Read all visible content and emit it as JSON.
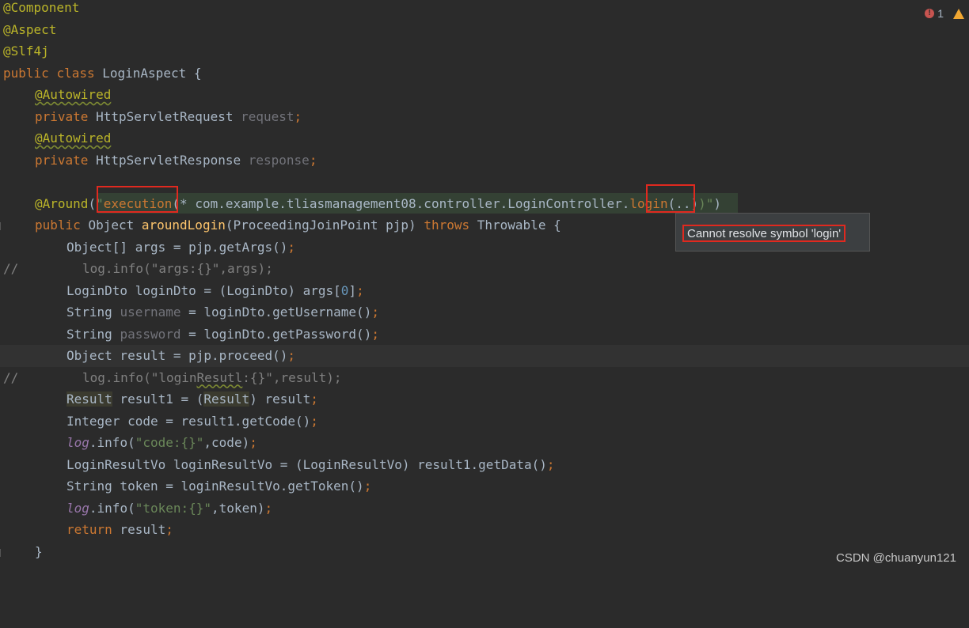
{
  "editor": {
    "l1": {
      "ann": "@Component"
    },
    "l2": {
      "ann": "@Aspect"
    },
    "l3": {
      "ann": "@Slf4j"
    },
    "l4": {
      "k1": "public",
      "k2": "class",
      "name": "LoginAspect",
      "brace": "{"
    },
    "l5": {
      "ann": "@Autowired"
    },
    "l6": {
      "k": "private",
      "type": "HttpServletRequest",
      "field": "request",
      "semi": ";"
    },
    "l7": {
      "ann": "@Autowired"
    },
    "l8": {
      "k": "private",
      "type": "HttpServletResponse",
      "field": "response",
      "semi": ";"
    },
    "l9": {
      "ann": "@Around",
      "p1": "(",
      "q1": "\"",
      "exec": "execution",
      "mid": "(* com.example.tliasmanagement08.controller.LoginController",
      "dot": ".",
      "login": "login",
      "args": "(..)",
      "q2": ")\"",
      "p2": ")"
    },
    "l10": {
      "k": "public",
      "type": "Object",
      "method": "aroundLogin",
      "params": "(ProceedingJoinPoint pjp)",
      "throws": "throws",
      "ex": "Throwable {"
    },
    "l11": {
      "a": "Object[] args = pjp.getArgs()",
      "semi": ";"
    },
    "l12": {
      "mark": "//",
      "text": "log.info(\"args:{}\",args);"
    },
    "l13": {
      "a": "LoginDto loginDto = (LoginDto) args[",
      "num": "0",
      "b": "]",
      "semi": ";"
    },
    "l14": {
      "a": "String ",
      "var": "username",
      "b": " = loginDto.getUsername()",
      "semi": ";"
    },
    "l15": {
      "a": "String ",
      "var": "password",
      "b": " = loginDto.getPassword()",
      "semi": ";"
    },
    "l16": {
      "a": "Object result = pjp.proceed()",
      "semi": ";"
    },
    "l17": {
      "mark": "//",
      "a": "log.info(\"login",
      "typo": "Resutl",
      "b": ":{}\",result);"
    },
    "l18": {
      "r1": "Result",
      "a": " result1 = (",
      "r2": "Result",
      "b": ") result",
      "semi": ";"
    },
    "l19": {
      "a": "Integer code = result1.getCode()",
      "semi": ";"
    },
    "l20": {
      "log": "log",
      "a": ".info(",
      "str": "\"code:{}\"",
      "b": ",code)",
      "semi": ";"
    },
    "l21": {
      "a": "LoginResultVo loginResultVo = (LoginResultVo) result1.getData()",
      "semi": ";"
    },
    "l22": {
      "a": "String token = loginResultVo.getToken()",
      "semi": ";"
    },
    "l23": {
      "log": "log",
      "a": ".info(",
      "str": "\"token:{}\"",
      "b": ",token)",
      "semi": ";"
    },
    "l24": {
      "k": "return",
      "a": " result",
      "semi": ";"
    },
    "l25": {
      "a": "}"
    }
  },
  "tooltip": {
    "text": "Cannot resolve symbol 'login'"
  },
  "inspections": {
    "errors": "1"
  },
  "watermark": "CSDN @chuanyun121"
}
